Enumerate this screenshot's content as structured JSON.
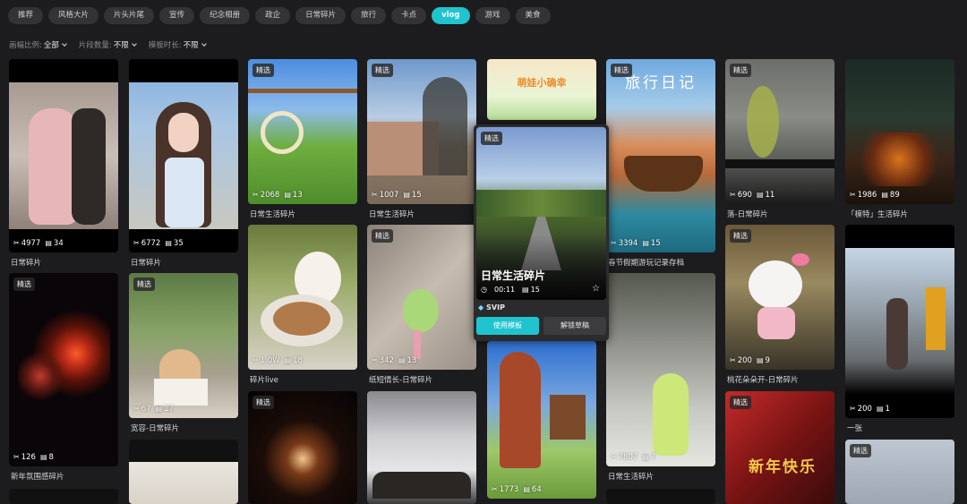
{
  "tabs": [
    "推荐",
    "风格大片",
    "片头片尾",
    "宣传",
    "纪念相册",
    "政企",
    "日常碎片",
    "旅行",
    "卡点",
    "vlog",
    "游戏",
    "美食"
  ],
  "active_tab": "vlog",
  "filters": [
    {
      "label": "画幅比例:",
      "value": "全部"
    },
    {
      "label": "片段数量:",
      "value": "不限"
    },
    {
      "label": "模板时长:",
      "value": "不限"
    }
  ],
  "featured_label": "精选",
  "cards": [
    {
      "uses": "4977",
      "clips": "34",
      "title": "日常碎片"
    },
    {
      "uses": "6772",
      "clips": "35",
      "title": "日常碎片"
    },
    {
      "uses": "2068",
      "clips": "13",
      "title": "日常生活碎片"
    },
    {
      "uses": "1007",
      "clips": "15",
      "title": "日常生活碎片"
    },
    {
      "uses": "3394",
      "clips": "15",
      "title": "春节假期游玩记录存档"
    },
    {
      "uses": "690",
      "clips": "11",
      "title": "落-日常碎片"
    },
    {
      "uses": "1986",
      "clips": "89",
      "title": "「模特」生活碎片"
    },
    {
      "uses": "126",
      "clips": "8",
      "title": "新年氛围感碎片"
    },
    {
      "uses": "67",
      "clips": "17",
      "title": "宽容-日常碎片"
    },
    {
      "uses": "1.0W",
      "clips": "18",
      "title": "碎片live"
    },
    {
      "uses": "342",
      "clips": "13",
      "title": "纸短情长-日常碎片"
    },
    {
      "uses": "200",
      "clips": "9",
      "title": "桃花朵朵开-日常碎片"
    },
    {
      "uses": "200",
      "clips": "1",
      "title": "一张"
    },
    {
      "uses": "7807",
      "clips": "7",
      "title": "日常生活碎片"
    },
    {
      "uses": "1773",
      "clips": "64",
      "title": ""
    }
  ],
  "overlay_texts": {
    "travel_diary": "旅行日记",
    "small_banner": "萌娃小确幸",
    "new_year": "新年快乐"
  },
  "popup": {
    "title": "日常生活碎片",
    "duration": "00:11",
    "clips": "15",
    "tier": "SVIP",
    "use_button": "使用模板",
    "unlock_button": "解锁草稿"
  },
  "colors": {
    "accent": "#1fc4cf",
    "background": "#1c1c1e"
  }
}
